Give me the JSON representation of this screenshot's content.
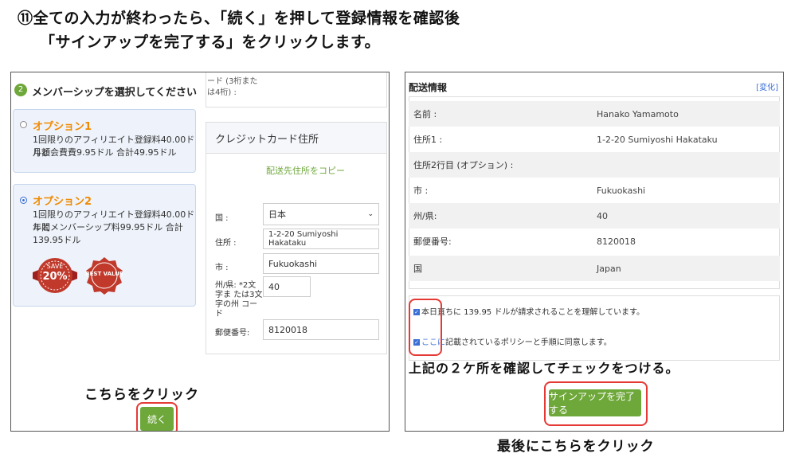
{
  "title": {
    "line1": "⑪全ての入力が終わったら、「続く」を押して登録情報を確認後",
    "line2": "「サインアップを完了する」をクリックします。"
  },
  "left_panel": {
    "step_number": "2",
    "section_title": "メンバーシップを選択してください",
    "option1": {
      "title": "オプション1",
      "line1": "1回限りのアフィリエイト登録料40.00ドルと",
      "line2": "月額会費費9.95ドル 合計49.95ドル"
    },
    "option2": {
      "title": "オプション2",
      "line1": "1回限りのアフィリエイト登録料40.00ドルと",
      "line2": "年間メンバーシップ料99.95ドル 合計139.95ドル"
    },
    "badge_save_top": "SAVE",
    "badge_save_pct": "20%",
    "badge_best": "BEST VALUE",
    "cvv_note_1": "ード (3桁また",
    "cvv_note_2": "は4桁) :",
    "card_address_title": "クレジットカード住所",
    "copy_link": "配送先住所をコピー",
    "country_label": "国 :",
    "country_value": "日本",
    "address_label": "住所 :",
    "address_value": "1-2-20 Sumiyoshi Hakataku",
    "city_label": "市 :",
    "city_value": "Fukuokashi",
    "state_label": "州/県: *2文字ま たは3文字の州 コード",
    "state_value": "40",
    "zip_label": "郵便番号:",
    "zip_value": "8120018",
    "click_caption": "こちらをクリック",
    "continue_button": "続く"
  },
  "right_panel": {
    "section_title": "配送情報",
    "change_link": "[変化]",
    "rows": [
      {
        "k": "名前 :",
        "v": "Hanako Yamamoto"
      },
      {
        "k": "住所1 :",
        "v": "1-2-20 Sumiyoshi Hakataku"
      },
      {
        "k": "住所2行目 (オプション) :",
        "v": ""
      },
      {
        "k": "市 :",
        "v": "Fukuokashi"
      },
      {
        "k": "州/県:",
        "v": "40"
      },
      {
        "k": "郵便番号:",
        "v": "8120018"
      },
      {
        "k": "国",
        "v": "Japan"
      }
    ],
    "agree1": "本日直ちに 139.95 ドルが請求されることを理解しています。",
    "agree2_link": "ここに",
    "agree2_rest": "記載されているポリシーと手順に同意します。",
    "check_caption": "上記の２ケ所を確認してチェックをつける。",
    "complete_button": "サインアップを完了する"
  },
  "final_caption": "最後にこちらをクリック"
}
